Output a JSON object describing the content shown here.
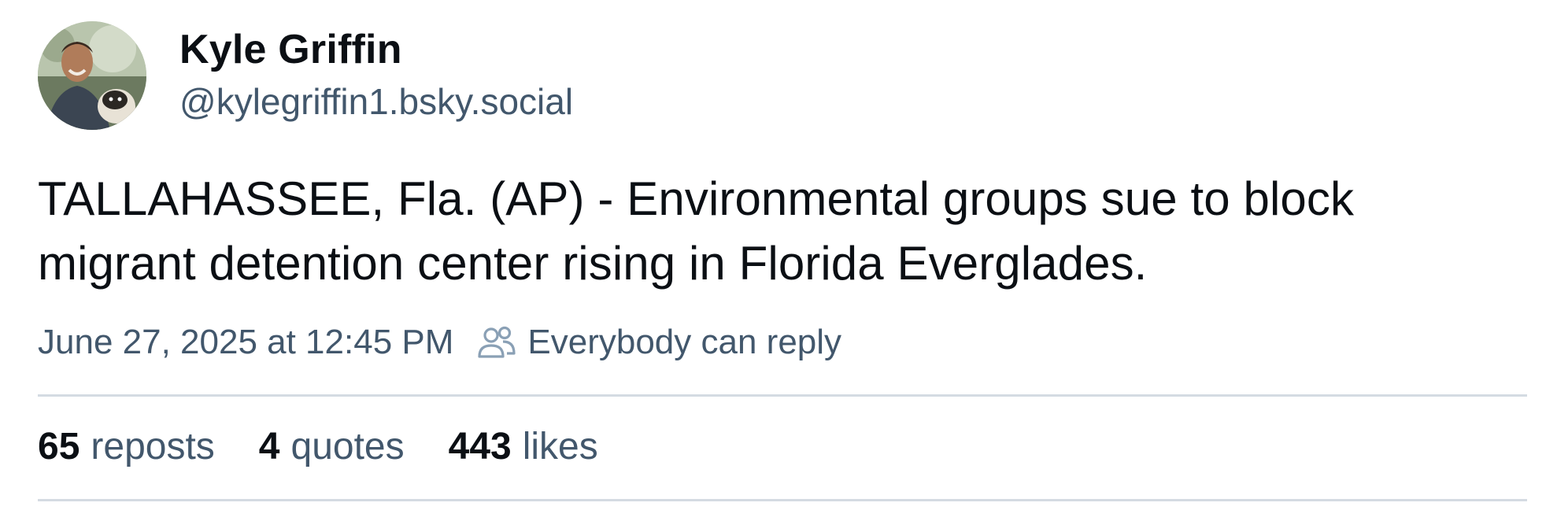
{
  "author": {
    "display_name": "Kyle Griffin",
    "handle": "@kylegriffin1.bsky.social",
    "avatar_icon": "profile-photo"
  },
  "post": {
    "text_line1": "TALLAHASSEE, Fla. (AP) - Environmental groups sue to block",
    "text_line2": "migrant detention center rising in Florida Everglades.",
    "timestamp": "June 27, 2025 at 12:45 PM",
    "reply_setting": "Everybody can reply",
    "reply_icon": "people-icon"
  },
  "stats": {
    "reposts_count": "65",
    "reposts_label": "reposts",
    "quotes_count": "4",
    "quotes_label": "quotes",
    "likes_count": "443",
    "likes_label": "likes"
  },
  "colors": {
    "text_primary": "#0b0f14",
    "text_secondary": "#42576c",
    "divider": "#d4dbe2",
    "background": "#ffffff"
  }
}
